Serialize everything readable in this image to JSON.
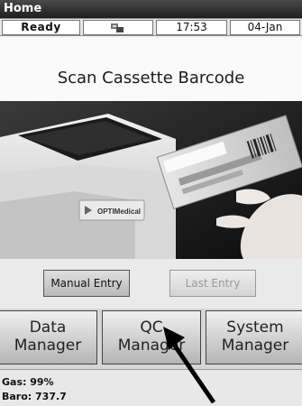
{
  "window": {
    "title": "Home"
  },
  "status": {
    "ready": "Ready",
    "icon": "network-icon",
    "time": "17:53",
    "date": "04-Jan"
  },
  "screen": {
    "prompt": "Scan Cassette Barcode"
  },
  "photo": {
    "device_brand": "OPTIMedical"
  },
  "entry": {
    "manual_label": "Manual Entry",
    "last_label": "Last Entry"
  },
  "managers": {
    "data_label": "Data\nManager",
    "qc_label": "QC\nManager",
    "system_label": "System\nManager"
  },
  "footer": {
    "gas": "Gas: 99%",
    "baro": "Baro: 737.7"
  },
  "colors": {
    "titlebar": "#2a2a2a",
    "button_face": "#d0d0d0",
    "disabled_text": "#999999"
  }
}
